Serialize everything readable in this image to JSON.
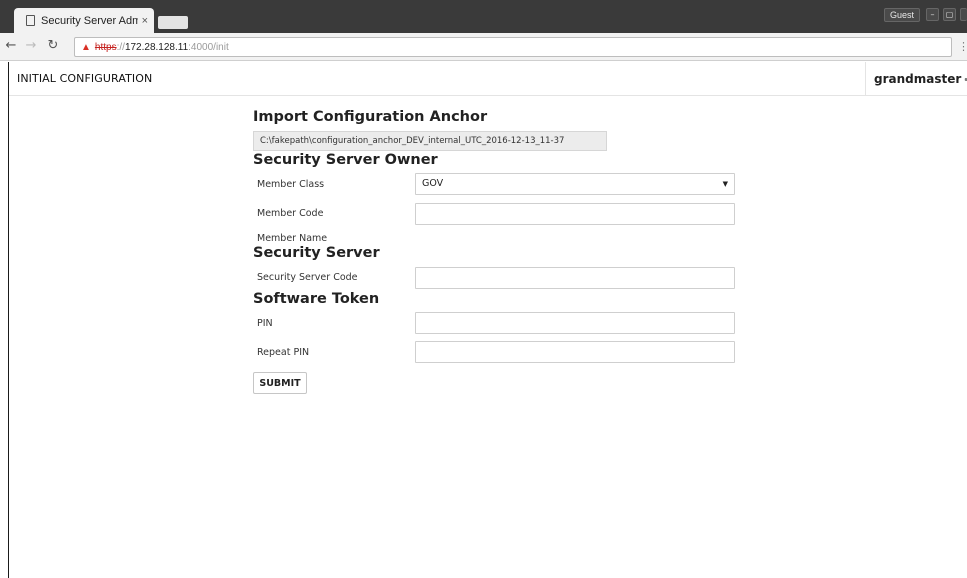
{
  "browser": {
    "tab_title": "Security Server Adm",
    "tab_close": "×",
    "user_chip": "Guest",
    "url_scheme": "https",
    "url_sep": "://",
    "url_host": "172.28.128.11",
    "url_path": ":4000/init"
  },
  "header": {
    "title": "INITIAL CONFIGURATION",
    "username": "grandmaster"
  },
  "anchor": {
    "heading": "Import Configuration Anchor",
    "file_path": "C:\\fakepath\\configuration_anchor_DEV_internal_UTC_2016-12-13_11-37"
  },
  "owner": {
    "heading": "Security Server Owner",
    "member_class_label": "Member Class",
    "member_class_value": "GOV",
    "member_code_label": "Member Code",
    "member_code_value": "",
    "member_name_label": "Member Name"
  },
  "server": {
    "heading": "Security Server",
    "code_label": "Security Server Code",
    "code_value": ""
  },
  "token": {
    "heading": "Software Token",
    "pin_label": "PIN",
    "pin_value": "",
    "repeat_pin_label": "Repeat PIN",
    "repeat_pin_value": ""
  },
  "actions": {
    "submit_label": "SUBMIT"
  }
}
